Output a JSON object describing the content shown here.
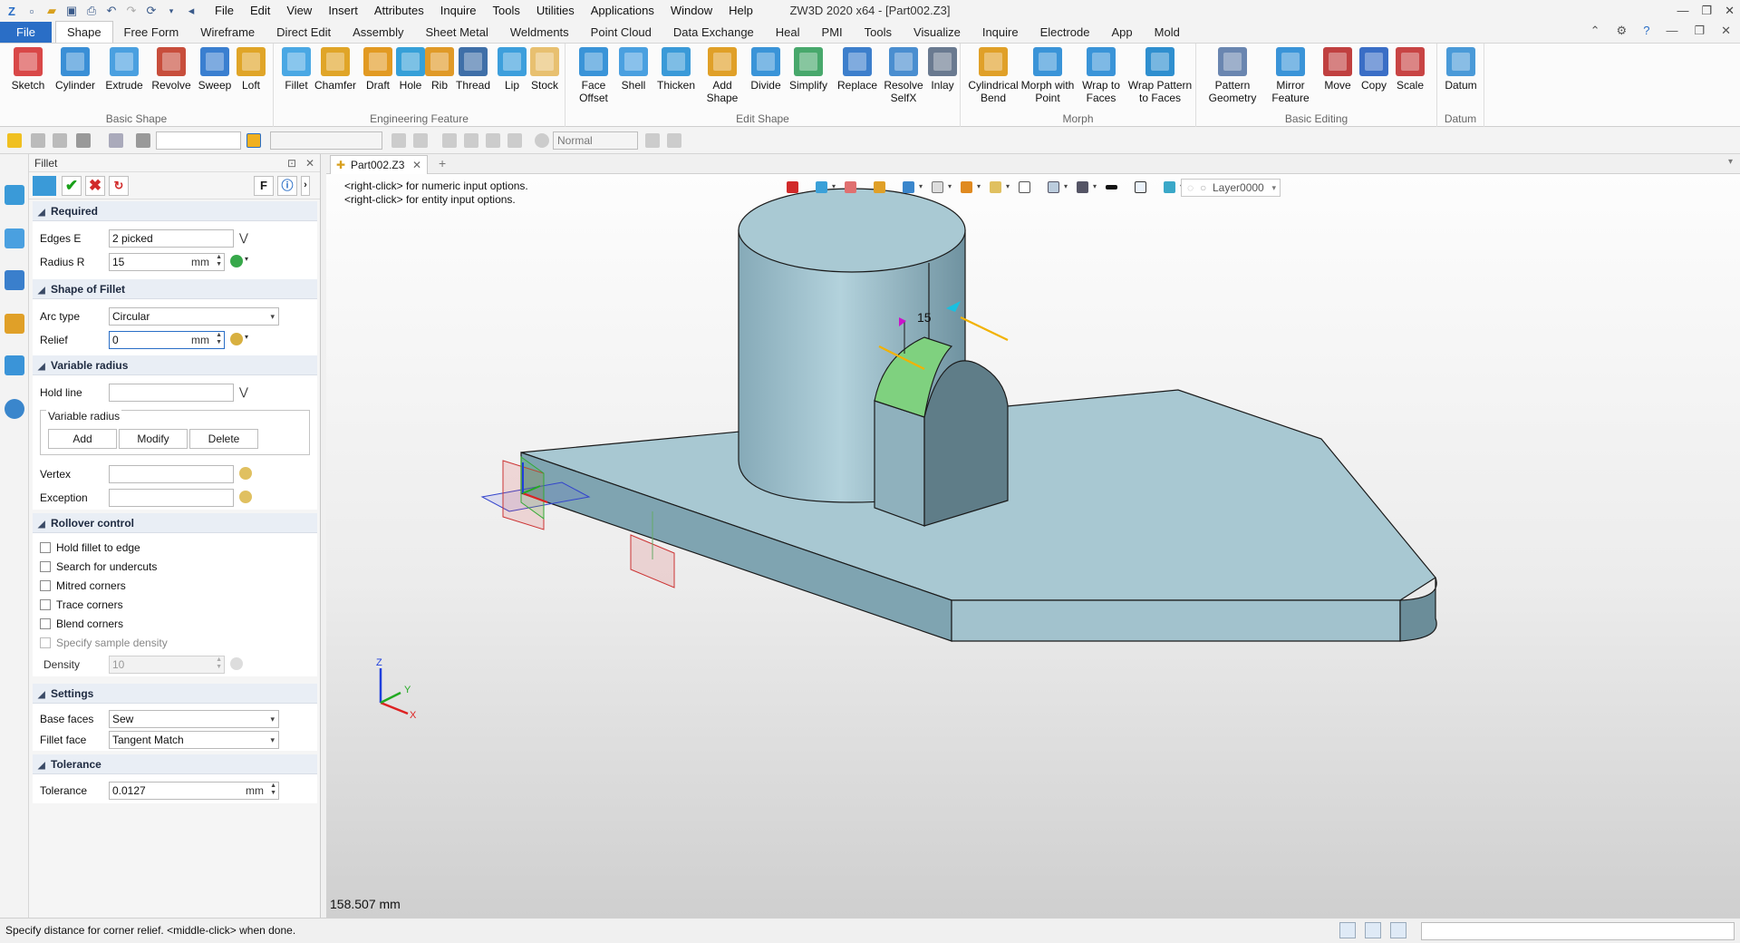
{
  "app": {
    "title": "ZW3D 2020 x64 - [Part002.Z3]"
  },
  "menu": [
    "File",
    "Edit",
    "View",
    "Insert",
    "Attributes",
    "Inquire",
    "Tools",
    "Utilities",
    "Applications",
    "Window",
    "Help"
  ],
  "ribbon_tabs": [
    "File",
    "Shape",
    "Free Form",
    "Wireframe",
    "Direct Edit",
    "Assembly",
    "Sheet Metal",
    "Weldments",
    "Point Cloud",
    "Data Exchange",
    "Heal",
    "PMI",
    "Tools",
    "Visualize",
    "Inquire",
    "Electrode",
    "App",
    "Mold"
  ],
  "active_ribbon_tab": "Shape",
  "ribbon_groups": [
    {
      "label": "Basic Shape",
      "buttons": [
        "Sketch",
        "Cylinder",
        "Extrude",
        "Revolve",
        "Sweep",
        "Loft"
      ]
    },
    {
      "label": "Engineering Feature",
      "buttons": [
        "Fillet",
        "Chamfer",
        "Draft",
        "Hole",
        "Rib",
        "Thread",
        "Lip",
        "Stock"
      ]
    },
    {
      "label": "Edit Shape",
      "buttons": [
        "Face Offset",
        "Shell",
        "Thicken",
        "Add Shape",
        "Divide",
        "Simplify",
        "Replace",
        "Resolve SelfX",
        "Inlay"
      ]
    },
    {
      "label": "Morph",
      "buttons": [
        "Cylindrical Bend",
        "Morph with Point",
        "Wrap to Faces",
        "Wrap Pattern to Faces"
      ]
    },
    {
      "label": "Basic Editing",
      "buttons": [
        "Pattern Geometry",
        "Mirror Feature",
        "Move",
        "Copy",
        "Scale"
      ]
    },
    {
      "label": "Datum",
      "buttons": [
        "Datum"
      ]
    }
  ],
  "toolbar2": {
    "render_mode": "Normal"
  },
  "panel": {
    "title": "Fillet",
    "f_button": "F",
    "sections": {
      "required": "Required",
      "shape": "Shape of Fillet",
      "variable": "Variable radius",
      "rollover": "Rollover control",
      "settings": "Settings",
      "tolerance": "Tolerance"
    },
    "edges_label": "Edges E",
    "edges_value": "2 picked",
    "radius_label": "Radius R",
    "radius_value": "15",
    "unit": "mm",
    "arc_type_label": "Arc type",
    "arc_type_value": "Circular",
    "relief_label": "Relief",
    "relief_value": "0",
    "hold_line_label": "Hold line",
    "variable_group_label": "Variable radius",
    "add_button": "Add",
    "modify_button": "Modify",
    "delete_button": "Delete",
    "vertex_label": "Vertex",
    "exception_label": "Exception",
    "rollover_options": [
      {
        "label": "Hold fillet to edge",
        "checked": false,
        "enabled": true
      },
      {
        "label": "Search for undercuts",
        "checked": false,
        "enabled": true
      },
      {
        "label": "Mitred corners",
        "checked": false,
        "enabled": true
      },
      {
        "label": "Trace corners",
        "checked": false,
        "enabled": true
      },
      {
        "label": "Blend corners",
        "checked": false,
        "enabled": true
      },
      {
        "label": "Specify sample density",
        "checked": false,
        "enabled": false
      }
    ],
    "density_label": "Density",
    "density_value": "10",
    "base_faces_label": "Base faces",
    "base_faces_value": "Sew",
    "fillet_face_label": "Fillet face",
    "fillet_face_value": "Tangent Match",
    "tolerance_label": "Tolerance",
    "tolerance_value": "0.0127"
  },
  "document_tab": "Part002.Z3",
  "viewport": {
    "hint_numeric": "<right-click> for numeric input options.",
    "hint_entity": "<right-click> for entity input options.",
    "layer": "Layer0000",
    "dimension_label": "15",
    "distance_readout": "158.507 mm",
    "triad_labels": {
      "x": "X",
      "y": "Y",
      "z": "Z"
    }
  },
  "statusbar": {
    "message": "Specify distance for corner relief.  <middle-click> when done."
  },
  "colors": {
    "accent": "#2a6ec6",
    "part_body": "#9fc0cc",
    "fillet_face": "#7fd17f",
    "highlight_edge": "#f2b200",
    "status_ok": "#19a019",
    "status_cancel": "#d12a2a"
  }
}
